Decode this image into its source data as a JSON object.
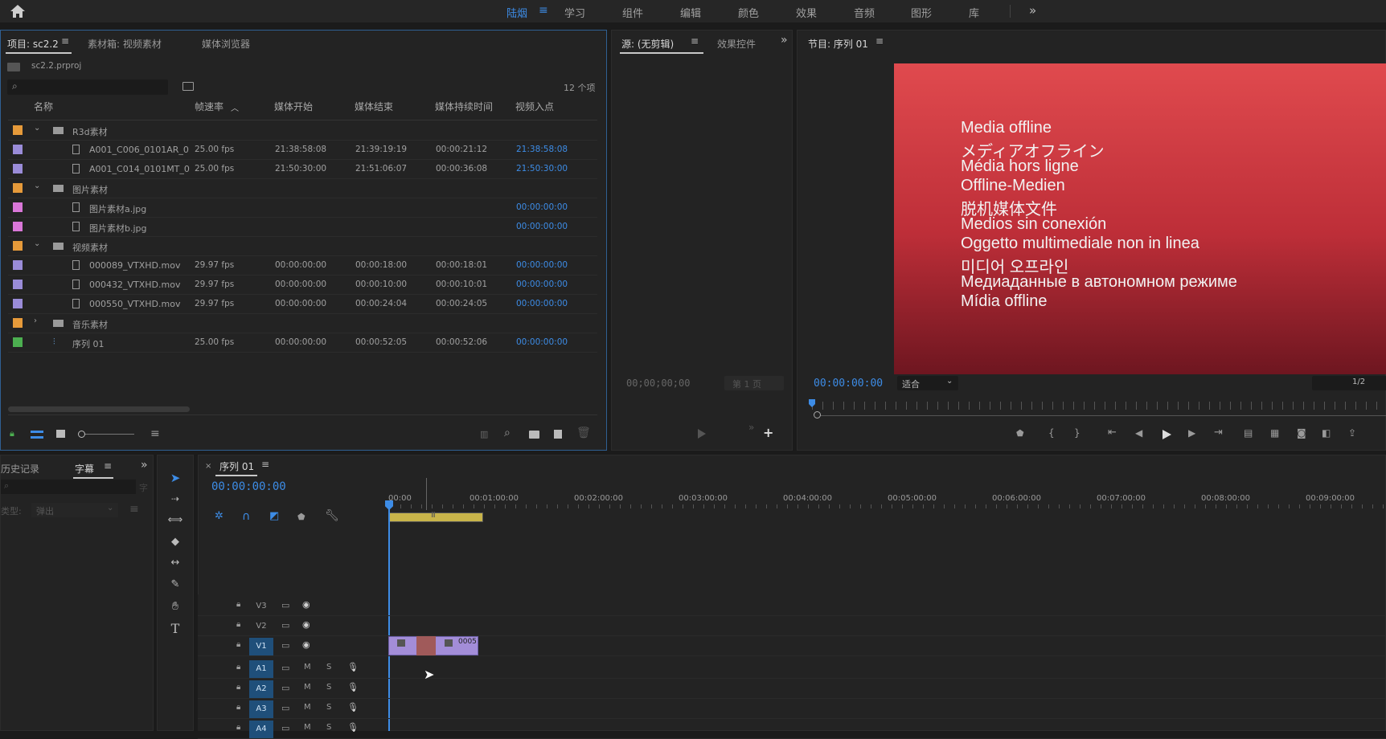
{
  "workspaces": {
    "items": [
      "陆烟",
      "学习",
      "组件",
      "编辑",
      "颜色",
      "效果",
      "音频",
      "图形",
      "库"
    ],
    "active": "陆烟",
    "more_icon": "double-chevron-right-icon",
    "home_icon": "home-icon"
  },
  "project_panel": {
    "tabs": [
      "项目: sc2.2",
      "素材箱: 视频素材",
      "媒体浏览器"
    ],
    "project_file": "sc2.2.prproj",
    "search_placeholder": "",
    "item_count": "12 个项",
    "columns": [
      "名称",
      "帧速率",
      "媒体开始",
      "媒体结束",
      "媒体持续时间",
      "视频入点"
    ],
    "rows": [
      {
        "color": "#e69a3a",
        "type": "folder",
        "expanded": true,
        "name": "R3d素材",
        "fps": "",
        "start": "",
        "end": "",
        "duration": "",
        "in": "",
        "indent": 0
      },
      {
        "color": "#9a8cd8",
        "type": "clip",
        "name": "A001_C006_0101AR_0",
        "fps": "25.00 fps",
        "start": "21:38:58:08",
        "end": "21:39:19:19",
        "duration": "00:00:21:12",
        "in": "21:38:58:08",
        "indent": 1
      },
      {
        "color": "#9a8cd8",
        "type": "clip",
        "name": "A001_C014_0101MT_0",
        "fps": "25.00 fps",
        "start": "21:50:30:00",
        "end": "21:51:06:07",
        "duration": "00:00:36:08",
        "in": "21:50:30:00",
        "indent": 1
      },
      {
        "color": "#e69a3a",
        "type": "folder",
        "expanded": true,
        "name": "图片素材",
        "fps": "",
        "start": "",
        "end": "",
        "duration": "",
        "in": "",
        "indent": 0
      },
      {
        "color": "#d977d8",
        "type": "image",
        "name": "图片素材a.jpg",
        "fps": "",
        "start": "",
        "end": "",
        "duration": "",
        "in": "00:00:00:00",
        "indent": 1
      },
      {
        "color": "#d977d8",
        "type": "image",
        "name": "图片素材b.jpg",
        "fps": "",
        "start": "",
        "end": "",
        "duration": "",
        "in": "00:00:00:00",
        "indent": 1
      },
      {
        "color": "#e69a3a",
        "type": "folder",
        "expanded": true,
        "name": "视频素材",
        "fps": "",
        "start": "",
        "end": "",
        "duration": "",
        "in": "",
        "indent": 0
      },
      {
        "color": "#9a8cd8",
        "type": "clip",
        "name": "000089_VTXHD.mov",
        "fps": "29.97 fps",
        "start": "00:00:00:00",
        "end": "00:00:18:00",
        "duration": "00:00:18:01",
        "in": "00:00:00:00",
        "indent": 1
      },
      {
        "color": "#9a8cd8",
        "type": "clip",
        "name": "000432_VTXHD.mov",
        "fps": "29.97 fps",
        "start": "00:00:00:00",
        "end": "00:00:10:00",
        "duration": "00:00:10:01",
        "in": "00:00:00:00",
        "indent": 1
      },
      {
        "color": "#9a8cd8",
        "type": "clip",
        "name": "000550_VTXHD.mov",
        "fps": "29.97 fps",
        "start": "00:00:00:00",
        "end": "00:00:24:04",
        "duration": "00:00:24:05",
        "in": "00:00:00:00",
        "indent": 1
      },
      {
        "color": "#e69a3a",
        "type": "folder",
        "expanded": false,
        "name": "音乐素材",
        "fps": "",
        "start": "",
        "end": "",
        "duration": "",
        "in": "",
        "indent": 0
      },
      {
        "color": "#4caf50",
        "type": "sequence",
        "name": "序列 01",
        "fps": "25.00 fps",
        "start": "00:00:00:00",
        "end": "00:00:52:05",
        "duration": "00:00:52:06",
        "in": "00:00:00:00",
        "indent": 0
      }
    ]
  },
  "source_panel": {
    "tabs": [
      "源: (无剪辑)",
      "效果控件"
    ],
    "timecode": "00;00;00;00",
    "page": "第 1 页"
  },
  "program_panel": {
    "tab": "节目: 序列 01",
    "timecode": "00:00:00:00",
    "fit": "适合",
    "resolution": "1/2",
    "offline_lines": [
      "Media offline",
      "メディアオフライン",
      "Média hors ligne",
      "Offline-Medien",
      "脱机媒体文件",
      "Medios sin conexión",
      "Oggetto multimediale non in linea",
      "미디어 오프라인",
      "Медиаданные в автономном режиме",
      "Mídia offline"
    ],
    "video_color_top": "#e04a4e",
    "video_color_bottom": "#6e1620"
  },
  "left_lower_panel": {
    "tabs": [
      "历史记录",
      "字幕"
    ],
    "search_placeholder": "",
    "type_label": "类型:",
    "type_value": "弹出",
    "trailing_label": "字"
  },
  "timeline": {
    "tab": "序列 01",
    "timecode": "00:00:00:00",
    "ruler": [
      "00:00",
      "00:01:00:00",
      "00:02:00:00",
      "00:03:00:00",
      "00:04:00:00",
      "00:05:00:00",
      "00:06:00:00",
      "00:07:00:00",
      "00:08:00:00",
      "00:09:00:00"
    ],
    "video_tracks": [
      "V3",
      "V2",
      "V1"
    ],
    "audio_tracks": [
      "A1",
      "A2",
      "A3",
      "A4"
    ],
    "mute_label": "M",
    "solo_label": "S",
    "clip_label": "0005",
    "accent": "#3d8ce6"
  }
}
